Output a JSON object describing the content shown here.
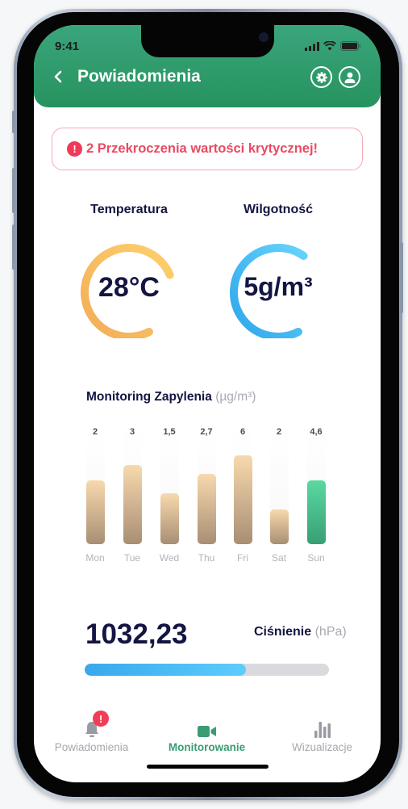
{
  "status_bar": {
    "time": "9:41"
  },
  "header": {
    "title": "Powiadomienia",
    "back_icon": "chevron-left-icon",
    "actions": [
      {
        "name": "settings",
        "icon": "gear-icon"
      },
      {
        "name": "profile",
        "icon": "user-icon"
      }
    ]
  },
  "alert": {
    "icon": "exclamation-icon",
    "text": "2 Przekroczenia wartości krytycznej!",
    "color": "#e84a63"
  },
  "gauges": [
    {
      "title": "Temperatura",
      "value": "28°C",
      "color_start": "#f2ad56",
      "color_end": "#fdd06f"
    },
    {
      "title": "Wilgotność",
      "value": "5g/m³",
      "color_start": "#2ea6ec",
      "color_end": "#66d3fb"
    }
  ],
  "dust_chart": {
    "title": "Monitoring Zapylenia",
    "unit": "(µg/m³)"
  },
  "chart_data": {
    "type": "bar",
    "title": "Monitoring Zapylenia (µg/m³)",
    "categories": [
      "Mon",
      "Tue",
      "Wed",
      "Thu",
      "Fri",
      "Sat",
      "Sun"
    ],
    "value_labels": [
      "2",
      "3",
      "1,5",
      "2,7",
      "6",
      "2",
      "4,6"
    ],
    "values": [
      2,
      3,
      1.5,
      2.7,
      6,
      2,
      4.6
    ],
    "bar_fill_fraction": [
      0.54,
      0.67,
      0.43,
      0.59,
      0.75,
      0.29,
      0.54
    ],
    "highlighted_category": "Sun",
    "xlabel": "",
    "ylabel": "",
    "grid": false,
    "colors": {
      "default": "#d9bd98",
      "highlight": "#4cc18f"
    }
  },
  "pressure": {
    "value": "1032,23",
    "label": "Ciśnienie",
    "unit": "(hPa)",
    "progress_fraction": 0.66
  },
  "tabbar": {
    "items": [
      {
        "label": "Powiadomienia",
        "icon": "bell-icon",
        "badge": "!",
        "active": false
      },
      {
        "label": "Monitorowanie",
        "icon": "video-camera-icon",
        "active": true
      },
      {
        "label": "Wizualizacje",
        "icon": "bar-chart-icon",
        "active": false
      }
    ]
  }
}
